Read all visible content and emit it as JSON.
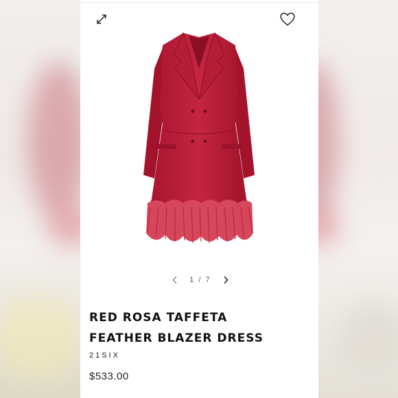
{
  "product": {
    "title_line1": "RED ROSA TAFFETA",
    "title_line2": "FEATHER BLAZER DRESS",
    "brand": "21SIX",
    "price": "$533.00",
    "image_alt": "Red double-breasted blazer dress with feather hem",
    "garment_color": "#b81c38"
  },
  "gallery": {
    "pager_text": "1 / 7"
  },
  "icons": {
    "expand": "expand-icon",
    "favorite": "heart-icon",
    "prev": "chevron-left-icon",
    "next": "chevron-right-icon"
  }
}
